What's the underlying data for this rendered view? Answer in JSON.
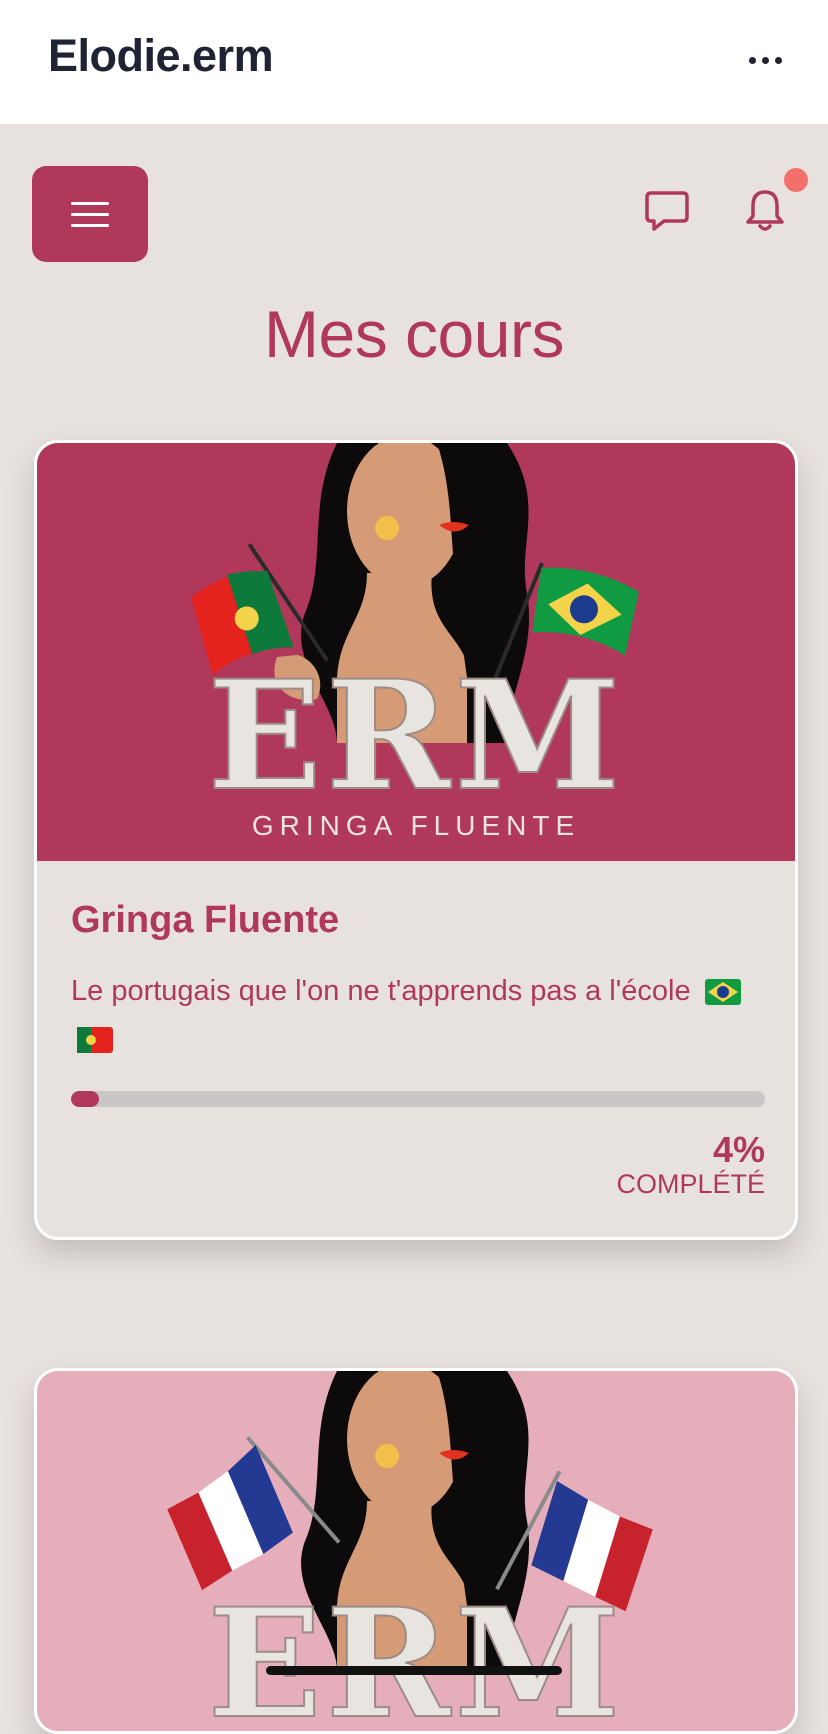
{
  "header": {
    "site_title": "Elodie.erm",
    "more_icon": "more-horizontal-icon"
  },
  "toolbar": {
    "menu_icon": "hamburger-menu-icon",
    "chat_icon": "chat-bubble-icon",
    "notification_icon": "bell-icon",
    "notification_dot_color": "#f36f6a"
  },
  "page": {
    "title": "Mes cours"
  },
  "courses": [
    {
      "banner_brand": "ERM",
      "banner_subtitle": "GRINGA FLUENTE",
      "banner_color": "#b0395b",
      "flags": [
        "portugal-flag",
        "brazil-flag"
      ],
      "title": "Gringa Fluente",
      "description": "Le portugais que l'on ne t'apprends pas a l'école",
      "description_flags": [
        "brazil-flag-icon",
        "portugal-flag-icon"
      ],
      "progress": 4,
      "progress_text": "4%",
      "progress_label": "COMPLÉTÉ"
    },
    {
      "banner_brand": "ERM",
      "banner_color": "#e6aebb",
      "flags": [
        "france-flag",
        "france-flag"
      ]
    }
  ],
  "colors": {
    "accent": "#b0395b",
    "background": "#e8e2df",
    "header_bg": "#ffffff",
    "track": "#cbc6c6"
  }
}
